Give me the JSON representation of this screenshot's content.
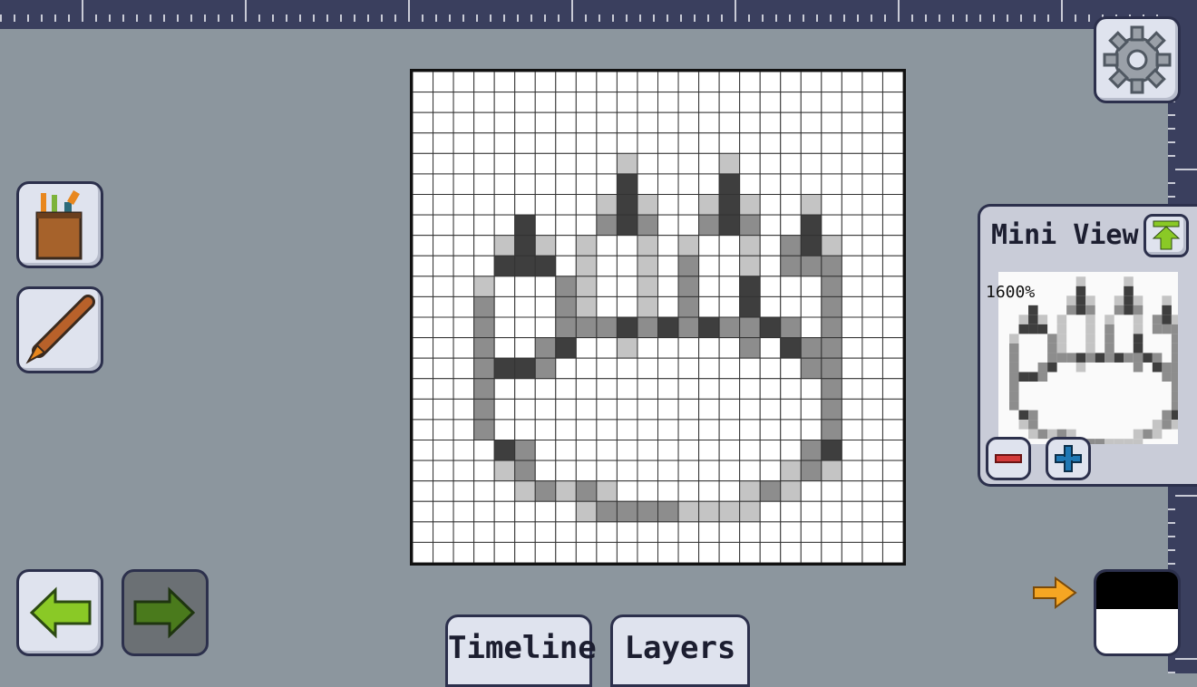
{
  "canvas": {
    "grid_cols": 24,
    "grid_rows": 24,
    "palette": {
      "W": "#ffffff",
      "L": "#c4c4c4",
      "M": "#8d8d8d",
      "D": "#3e3e3e"
    },
    "pixels": [
      "WWWWWWWWWWWWWWWWWWWWWWWW",
      "WWWWWWWWWWWWWWWWWWWWWWWW",
      "WWWWWWWWWWWWWWWWWWWWWWWW",
      "WWWWWWWWWWWWWWWWWWWWWWWW",
      "WWWWWWWWWWLWWWWLWWWWWWWW",
      "WWWWWWWWWWDWWWWDWWWWWWWW",
      "WWWWWWWWWLDLWWLDLWWLWWWW",
      "WWWWWDWWWMDMWWMDMWWDWWWW",
      "WWWWLDLWLWWLWLWWLWMDLWWW",
      "WWWWDDDWLWWLWMWWLWMMMWWW",
      "WWWLWWWMLWWLWMWWDWWWMWWW",
      "WWWMWWWMLWWLWMWWDWWWMWWW",
      "WWWMWWWMMMDMDMDMMDMWMWWW",
      "WWWMWWMDWWLWWWWWMWDMMWWW",
      "WWWMDDMWWWWWWWWWWWWMMWWW",
      "WWWMWWWWWWWWWWWWWWWWMWWW",
      "WWWMWWWWWWWWWWWWWWWWMWWW",
      "WWWMWWWWWWWWWWWWWWWWMWWW",
      "WWWWDMWWWWWWWWWWWWWMDWWW",
      "WWWWLMWWWWWWWWWWWWLMLWWW",
      "WWWWWLMLMLWWWWWWLMLWWWWW",
      "WWWWWWWWLMMMMLLLLWWWWWWW",
      "WWWWWWWWWWWWWWWWWWWWWWWW",
      "WWWWWWWWWWWWWWWWWWWWWWWW"
    ]
  },
  "toolbar": {
    "tools": [
      {
        "name": "brushes-jar-icon"
      },
      {
        "name": "pencil-icon"
      }
    ],
    "undo_icon": "left-arrow-icon",
    "redo_icon": "right-arrow-icon",
    "settings_icon": "gear-icon"
  },
  "mini_view": {
    "title": "Mini View",
    "zoom": "1600%",
    "pin_icon": "pin-icon",
    "zoom_out_icon": "minus-icon",
    "zoom_in_icon": "plus-icon"
  },
  "tabs": {
    "timeline": "Timeline",
    "layers": "Layers"
  },
  "colors": {
    "primary": "#000000",
    "secondary": "#ffffff",
    "swap_icon": "arrow-right-icon"
  }
}
